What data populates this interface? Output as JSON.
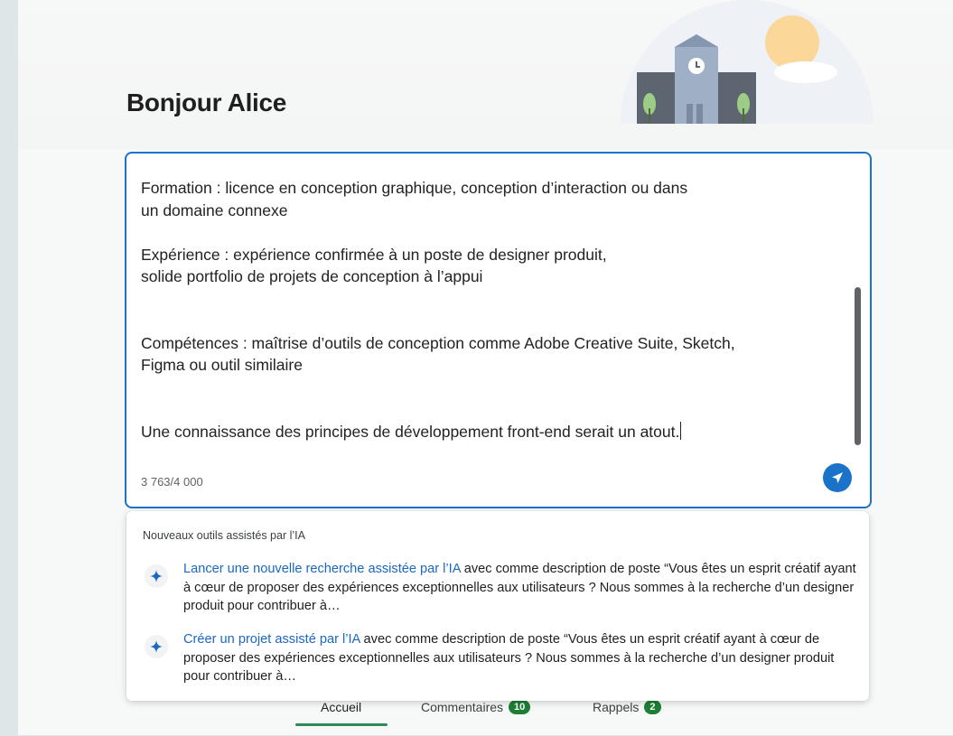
{
  "greeting": "Bonjour Alice",
  "composer": {
    "text": "Formation : licence en conception graphique, conception d’interaction ou dans\nun domaine connexe\n\nExpérience : expérience confirmée à un poste de designer produit,\nsolide portfolio de projets de conception à l’appui\n\n\nCompétences : maîtrise d’outils de conception comme Adobe Creative Suite, Sketch,\nFigma ou outil similaire\n\n\nUne connaissance des principes de développement front-end serait un atout.",
    "counter": "3 763/4 000",
    "send_icon": "send-icon"
  },
  "suggestions": {
    "header": "Nouveaux outils assistés par l’IA",
    "items": [
      {
        "link": "Lancer une nouvelle recherche assistée par l’IA",
        "text": " avec comme description de poste “Vous êtes un esprit créatif ayant à cœur de proposer des expériences exceptionnelles aux utilisateurs ? Nous sommes à la recherche d’un designer produit pour contribuer à…",
        "icon": "sparkle-icon"
      },
      {
        "link": "Créer un projet assisté par l’IA",
        "text": " avec comme description de poste “Vous êtes un esprit créatif ayant à cœur de proposer des expériences exceptionnelles aux utilisateurs ? Nous sommes à la recherche d’un designer produit pour contribuer à…",
        "icon": "sparkle-icon"
      }
    ]
  },
  "tabs": [
    {
      "label": "Accueil",
      "active": true
    },
    {
      "label": "Commentaires",
      "badge": "10"
    },
    {
      "label": "Rappels",
      "badge": "2"
    }
  ],
  "colors": {
    "accent": "#1a73c8",
    "link": "#1a67c4",
    "badge": "#1e7e34",
    "active_tab": "#2e8b57"
  }
}
